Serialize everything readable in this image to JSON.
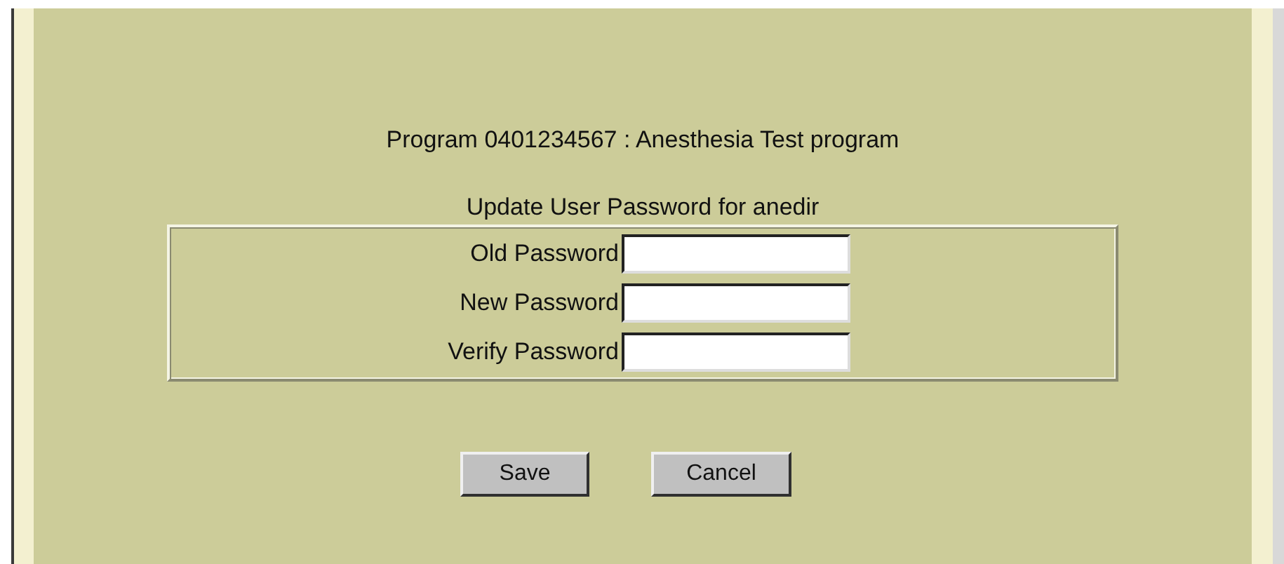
{
  "program_title": "Program 0401234567 : Anesthesia Test program",
  "form": {
    "title": "Update User Password for anedir",
    "fields": [
      {
        "label": "Old Password"
      },
      {
        "label": "New Password"
      },
      {
        "label": "Verify Password"
      }
    ]
  },
  "buttons": [
    "Save",
    "Cancel"
  ]
}
